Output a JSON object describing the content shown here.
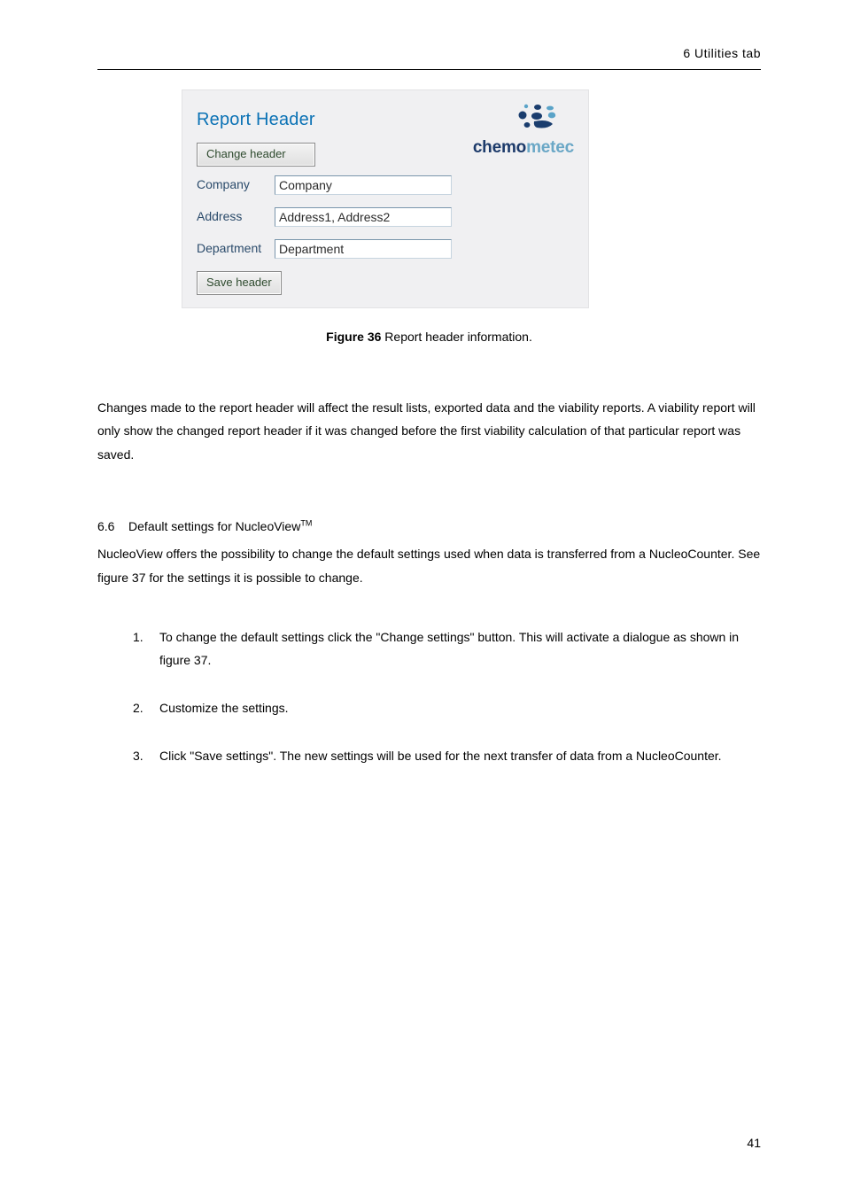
{
  "running_head": "6 Utilities tab",
  "ui": {
    "title": "Report Header",
    "logo": {
      "strong": "chemo",
      "light": "metec"
    },
    "change_button": "Change header",
    "fields": {
      "company": {
        "label": "Company",
        "value": "Company"
      },
      "address": {
        "label": "Address",
        "value": "Address1, Address2"
      },
      "department": {
        "label": "Department",
        "value": "Department"
      }
    },
    "save_button": "Save header"
  },
  "caption": {
    "bold": "Figure 36",
    "rest": " Report header information."
  },
  "para1": "Changes made to the report header will affect the result lists, exported data and the viability reports. A viability report will only show the changed report header if it was changed before the first viability calculation of that particular report was saved.",
  "section": {
    "num": "6.6",
    "title_a": "Default settings for NucleoView",
    "title_sup": "TM"
  },
  "para2": "NucleoView offers the possibility to change the default settings used when data is transferred from a NucleoCounter. See figure 37 for the settings it is possible to change.",
  "list": [
    {
      "n": "1.",
      "t": "To change the default settings click the \"Change settings\" button. This will activate a dialogue as shown in figure 37."
    },
    {
      "n": "2.",
      "t": "Customize the settings."
    },
    {
      "n": "3.",
      "t": "Click \"Save settings\". The new settings will be used for the next transfer of data from a NucleoCounter."
    }
  ],
  "page_number": "41"
}
